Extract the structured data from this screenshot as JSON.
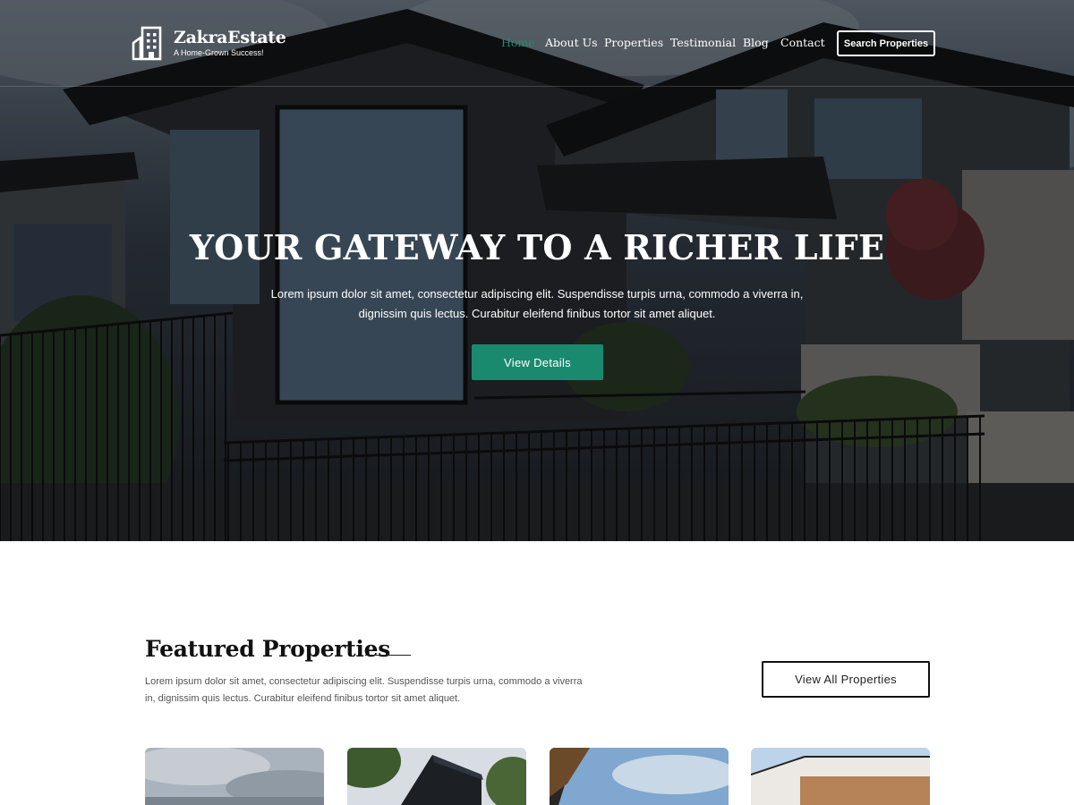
{
  "brand": {
    "name": "ZakraEstate",
    "tagline": "A Home-Grown Success!",
    "logo_icon": "building-icon"
  },
  "nav": {
    "items": [
      {
        "label": "Home",
        "active": true
      },
      {
        "label": "About Us",
        "active": false
      },
      {
        "label": "Properties",
        "active": false
      },
      {
        "label": "Testimonial",
        "active": false
      },
      {
        "label": "Blog",
        "active": false
      },
      {
        "label": "Contact",
        "active": false
      }
    ],
    "search_button": "Search Properties"
  },
  "hero": {
    "title": "YOUR GATEWAY TO A RICHER LIFE",
    "text": "Lorem ipsum dolor sit amet, consectetur adipiscing elit. Suspendisse turpis urna, commodo a viverra in, dignissim quis lectus. Curabitur eleifend finibus tortor sit amet aliquet.",
    "button": "View Details"
  },
  "featured": {
    "title": "Featured Properties",
    "text": "Lorem ipsum dolor sit amet, consectetur adipiscing elit. Suspendisse turpis urna, commodo a viverra in, dignissim quis lectus. Curabitur eleifend finibus tortor sit amet aliquet.",
    "button": "View All Properties"
  },
  "colors": {
    "accent": "#1a8a6f",
    "nav_active": "#1f8a70",
    "heading": "#111111",
    "body_text": "#555555"
  }
}
